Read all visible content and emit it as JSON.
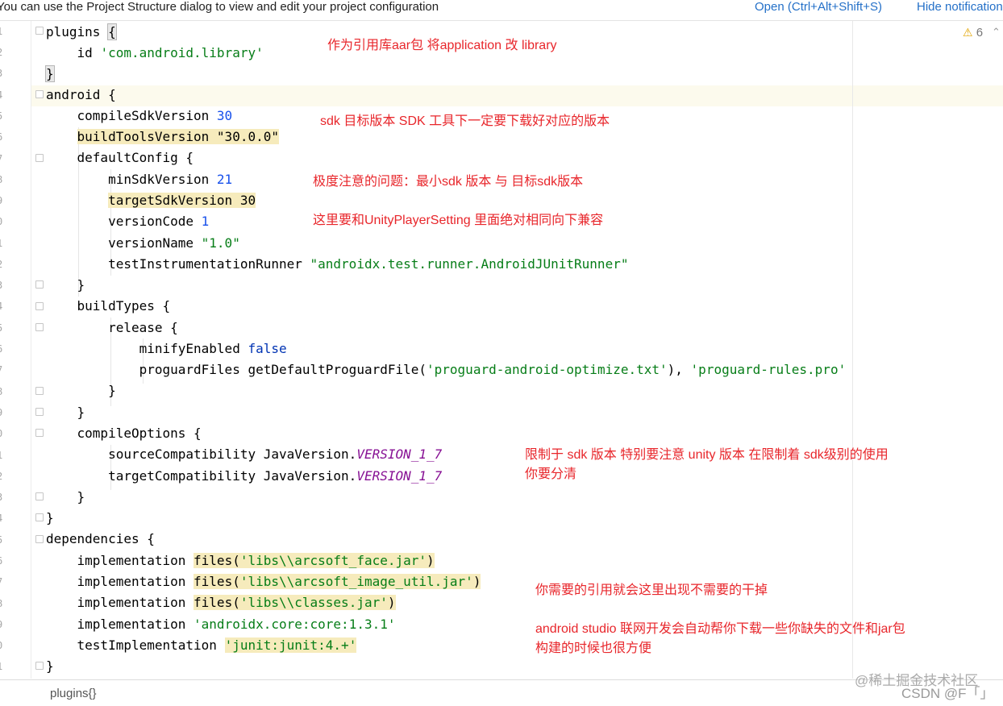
{
  "notification": {
    "message": "You can use the Project Structure dialog to view and edit your project configuration",
    "open_link": "Open (Ctrl+Alt+Shift+S)",
    "hide_link": "Hide notification"
  },
  "gutter": {
    "line_numbers": [
      "1",
      "2",
      "3",
      "4",
      "5",
      "6",
      "7",
      "8",
      "9",
      "0",
      "1",
      "2",
      "3",
      "4",
      "5",
      "6",
      "7",
      "8",
      "9",
      "0",
      "1",
      "2",
      "3",
      "4",
      "5",
      "6",
      "7",
      "8",
      "9",
      "0",
      "1"
    ]
  },
  "inspections": {
    "warning_count": "6"
  },
  "code": {
    "l1": "plugins ",
    "l1_brace": "{",
    "l2_a": "    id ",
    "l2_s": "'com.android.library'",
    "l3_brace": "}",
    "l4": "android {",
    "l5_a": "    compileSdkVersion ",
    "l5_n": "30",
    "l6_a": "    ",
    "l6_b": "buildToolsVersion \"30.0.0\"",
    "l7": "    defaultConfig {",
    "l8_a": "        minSdkVersion ",
    "l8_n": "21",
    "l9_a": "        ",
    "l9_b": "targetSdkVersion 30",
    "l10_a": "        versionCode ",
    "l10_n": "1",
    "l11_a": "        versionName ",
    "l11_s": "\"1.0\"",
    "l12_a": "        testInstrumentationRunner ",
    "l12_s": "\"androidx.test.runner.AndroidJUnitRunner\"",
    "l13": "    }",
    "l14": "    buildTypes {",
    "l15": "        release {",
    "l16_a": "            minifyEnabled ",
    "l16_k": "false",
    "l17_a": "            proguardFiles getDefaultProguardFile(",
    "l17_s1": "'proguard-android-optimize.txt'",
    "l17_b": "), ",
    "l17_s2": "'proguard-rules.pro'",
    "l18": "        }",
    "l19": "    }",
    "l20": "    compileOptions {",
    "l21_a": "        sourceCompatibility JavaVersion.",
    "l21_i": "VERSION_1_7",
    "l22_a": "        targetCompatibility JavaVersion.",
    "l22_i": "VERSION_1_7",
    "l23": "    }",
    "l24": "}",
    "l25": "dependencies {",
    "l26_a": "    implementation ",
    "l26_b1": "files(",
    "l26_s": "'libs\\\\arcsoft_face.jar'",
    "l26_b2": ")",
    "l27_a": "    implementation ",
    "l27_b1": "files(",
    "l27_s": "'libs\\\\arcsoft_image_util.jar'",
    "l27_b2": ")",
    "l28_a": "    implementation ",
    "l28_b1": "files(",
    "l28_s": "'libs\\\\classes.jar'",
    "l28_b2": ")",
    "l29_a": "    implementation ",
    "l29_s": "'androidx.core:core:1.3.1'",
    "l30_a": "    testImplementation ",
    "l30_s": "'junit:junit:4.+'",
    "l31": "}"
  },
  "annotations": {
    "a1": "作为引用库aar包     将application  改  library",
    "a2": "sdk 目标版本 SDK 工具下一定要下载好对应的版本",
    "a3": "极度注意的问题：最小sdk 版本  与  目标sdk版本",
    "a4": "这里要和UnityPlayerSetting 里面绝对相同向下兼容",
    "a5_line1": "限制于 sdk 版本 特别要注意 unity 版本 在限制着  sdk级别的使用",
    "a5_line2": "你要分清",
    "a6": "你需要的引用就会这里出现不需要的干掉",
    "a7_line1": "android studio 联网开发会自动帮你下载一些你缺失的文件和jar包",
    "a7_line2": "构建的时候也很方便"
  },
  "status": {
    "breadcrumb": "plugins{}"
  },
  "watermarks": {
    "juejin": "@稀土掘金技术社区",
    "csdn": "CSDN @F「」"
  }
}
